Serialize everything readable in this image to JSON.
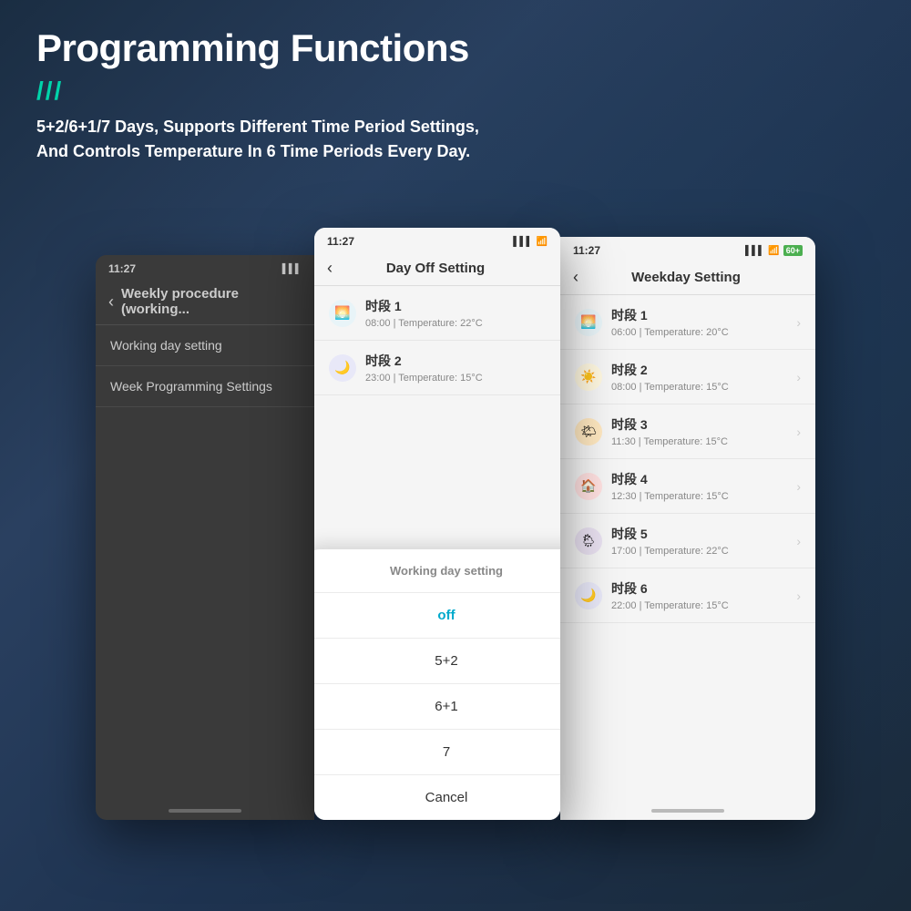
{
  "header": {
    "title": "Programming Functions",
    "accent": "///",
    "subtitle_line1": "5+2/6+1/7 Days, Supports Different Time Period Settings,",
    "subtitle_line2": "And Controls Temperature In 6 Time Periods Every Day."
  },
  "phone1": {
    "status_time": "11:27",
    "nav_back": "‹",
    "nav_title": "Weekly procedure (working...",
    "list_items": [
      "Working day setting",
      "Week Programming Settings"
    ]
  },
  "phone2": {
    "status_time": "11:27",
    "nav_back": "‹",
    "nav_title": "Day Off Setting",
    "periods": [
      {
        "icon": "🌅",
        "name": "时段 1",
        "time": "08:00  |  Temperature: 22°C"
      },
      {
        "icon": "🌙",
        "name": "时段 2",
        "time": "23:00  |  Temperature: 15°C"
      }
    ]
  },
  "phone3": {
    "status_time": "11:27",
    "nav_back": "‹",
    "nav_title": "Weekday Setting",
    "periods": [
      {
        "icon": "🌅",
        "name": "时段 1",
        "time": "06:00  |  Temperature: 20°C"
      },
      {
        "icon": "☀️",
        "name": "时段 2",
        "time": "08:00  |  Temperature: 15°C"
      },
      {
        "icon": "🌤",
        "name": "时段 3",
        "time": "11:30  |  Temperature: 15°C"
      },
      {
        "icon": "🏠",
        "name": "时段 4",
        "time": "12:30  |  Temperature: 15°C"
      },
      {
        "icon": "🌦",
        "name": "时段 5",
        "time": "17:00  |  Temperature: 22°C"
      },
      {
        "icon": "🌙",
        "name": "时段 6",
        "time": "22:00  |  Temperature: 15°C"
      }
    ]
  },
  "popup": {
    "header": "Working day setting",
    "options": [
      "off",
      "5+2",
      "6+1",
      "7"
    ],
    "cancel": "Cancel",
    "active_option": "off"
  },
  "colors": {
    "accent": "#00d4aa",
    "dark_bg": "#3a3a3a",
    "light_bg": "#f5f5f5"
  }
}
